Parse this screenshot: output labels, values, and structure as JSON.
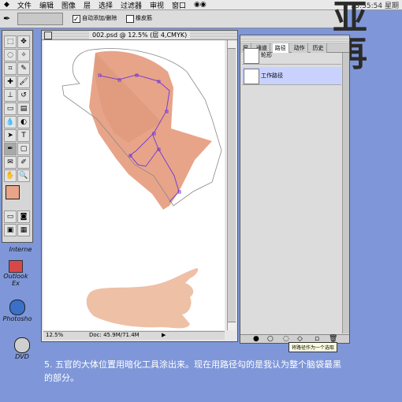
{
  "menubar": {
    "items": [
      "文件",
      "编辑",
      "图像",
      "层",
      "选择",
      "过滤器",
      "审视",
      "窗口"
    ],
    "clock": "13:55:54 星期"
  },
  "optbar": {
    "auto_add_label": "自动添加/删除",
    "rubber_label": "橡皮筋"
  },
  "document": {
    "title": "002.psd @ 12.5% (层 4,CMYK)",
    "zoom": "12.5%",
    "doc_size": "Doc: 45.9M/71.4M"
  },
  "palette": {
    "tabs": [
      "层",
      "通道",
      "路径",
      "动作",
      "历史"
    ],
    "paths": [
      {
        "label": "轮形"
      },
      {
        "label": "工作路径"
      }
    ],
    "tooltip": "将路径作为一个选取"
  },
  "desktop": {
    "icons": [
      {
        "label": "Interne",
        "icon": "internet-icon"
      },
      {
        "label": "Outlook Ex",
        "icon": "outlook-icon"
      },
      {
        "label": "Photosho",
        "icon": "photoshop-icon"
      },
      {
        "label": "DVD",
        "icon": "dvd-icon"
      }
    ]
  },
  "bigtext": "亚\n再",
  "caption": "5. 五官的大体位置用暗化工具涂出来。现在用路径勾的是我认为整个脑袋最黑的部分。",
  "colors": {
    "desktop": "#7f97d8",
    "skin": "#e8a489",
    "path": "#7a3fd0",
    "selected": "#c9d2ff"
  }
}
